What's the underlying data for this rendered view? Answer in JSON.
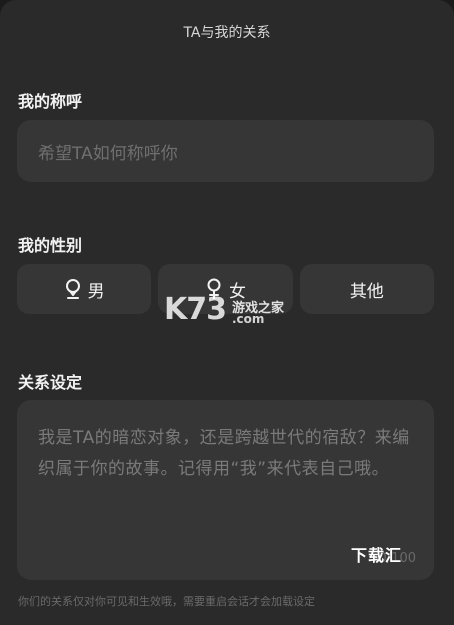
{
  "header": {
    "title": "TA与我的关系"
  },
  "nickname": {
    "label": "我的称呼",
    "placeholder": "希望TA如何称呼你"
  },
  "gender": {
    "label": "我的性别",
    "options": [
      {
        "label": "男",
        "icon": "male-symbol-icon"
      },
      {
        "label": "女",
        "icon": "female-symbol-icon"
      },
      {
        "label": "其他"
      }
    ]
  },
  "relation": {
    "label": "关系设定",
    "placeholder": "我是TA的暗恋对象，还是跨越世代的宿敌？来编织属于你的故事。记得用“我”来代表自己哦。",
    "char_count": "0/100"
  },
  "footer": {
    "note": "你们的关系仅对你可见和生效哦，需要重启会话才会加载设定"
  },
  "watermark": {
    "logo": "K73",
    "site_cn": "游戏之家",
    "site_com": ".com",
    "download": "下载汇"
  }
}
